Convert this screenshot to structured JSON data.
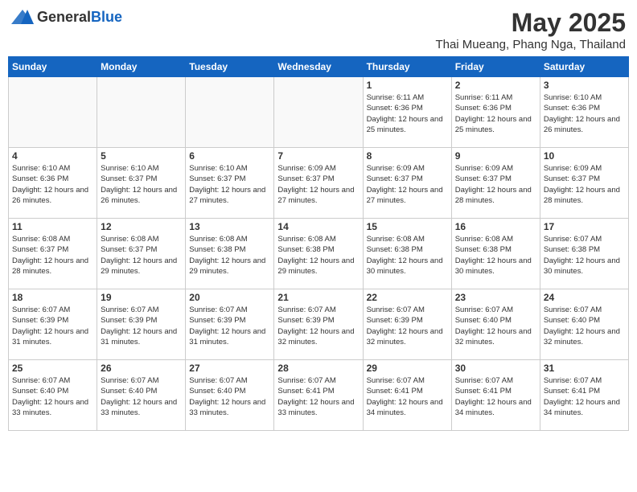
{
  "header": {
    "logo_general": "General",
    "logo_blue": "Blue",
    "title": "May 2025",
    "subtitle": "Thai Mueang, Phang Nga, Thailand"
  },
  "calendar": {
    "days_of_week": [
      "Sunday",
      "Monday",
      "Tuesday",
      "Wednesday",
      "Thursday",
      "Friday",
      "Saturday"
    ],
    "weeks": [
      [
        {
          "day": "",
          "info": ""
        },
        {
          "day": "",
          "info": ""
        },
        {
          "day": "",
          "info": ""
        },
        {
          "day": "",
          "info": ""
        },
        {
          "day": "1",
          "info": "Sunrise: 6:11 AM\nSunset: 6:36 PM\nDaylight: 12 hours\nand 25 minutes."
        },
        {
          "day": "2",
          "info": "Sunrise: 6:11 AM\nSunset: 6:36 PM\nDaylight: 12 hours\nand 25 minutes."
        },
        {
          "day": "3",
          "info": "Sunrise: 6:10 AM\nSunset: 6:36 PM\nDaylight: 12 hours\nand 26 minutes."
        }
      ],
      [
        {
          "day": "4",
          "info": "Sunrise: 6:10 AM\nSunset: 6:36 PM\nDaylight: 12 hours\nand 26 minutes."
        },
        {
          "day": "5",
          "info": "Sunrise: 6:10 AM\nSunset: 6:37 PM\nDaylight: 12 hours\nand 26 minutes."
        },
        {
          "day": "6",
          "info": "Sunrise: 6:10 AM\nSunset: 6:37 PM\nDaylight: 12 hours\nand 27 minutes."
        },
        {
          "day": "7",
          "info": "Sunrise: 6:09 AM\nSunset: 6:37 PM\nDaylight: 12 hours\nand 27 minutes."
        },
        {
          "day": "8",
          "info": "Sunrise: 6:09 AM\nSunset: 6:37 PM\nDaylight: 12 hours\nand 27 minutes."
        },
        {
          "day": "9",
          "info": "Sunrise: 6:09 AM\nSunset: 6:37 PM\nDaylight: 12 hours\nand 28 minutes."
        },
        {
          "day": "10",
          "info": "Sunrise: 6:09 AM\nSunset: 6:37 PM\nDaylight: 12 hours\nand 28 minutes."
        }
      ],
      [
        {
          "day": "11",
          "info": "Sunrise: 6:08 AM\nSunset: 6:37 PM\nDaylight: 12 hours\nand 28 minutes."
        },
        {
          "day": "12",
          "info": "Sunrise: 6:08 AM\nSunset: 6:37 PM\nDaylight: 12 hours\nand 29 minutes."
        },
        {
          "day": "13",
          "info": "Sunrise: 6:08 AM\nSunset: 6:38 PM\nDaylight: 12 hours\nand 29 minutes."
        },
        {
          "day": "14",
          "info": "Sunrise: 6:08 AM\nSunset: 6:38 PM\nDaylight: 12 hours\nand 29 minutes."
        },
        {
          "day": "15",
          "info": "Sunrise: 6:08 AM\nSunset: 6:38 PM\nDaylight: 12 hours\nand 30 minutes."
        },
        {
          "day": "16",
          "info": "Sunrise: 6:08 AM\nSunset: 6:38 PM\nDaylight: 12 hours\nand 30 minutes."
        },
        {
          "day": "17",
          "info": "Sunrise: 6:07 AM\nSunset: 6:38 PM\nDaylight: 12 hours\nand 30 minutes."
        }
      ],
      [
        {
          "day": "18",
          "info": "Sunrise: 6:07 AM\nSunset: 6:39 PM\nDaylight: 12 hours\nand 31 minutes."
        },
        {
          "day": "19",
          "info": "Sunrise: 6:07 AM\nSunset: 6:39 PM\nDaylight: 12 hours\nand 31 minutes."
        },
        {
          "day": "20",
          "info": "Sunrise: 6:07 AM\nSunset: 6:39 PM\nDaylight: 12 hours\nand 31 minutes."
        },
        {
          "day": "21",
          "info": "Sunrise: 6:07 AM\nSunset: 6:39 PM\nDaylight: 12 hours\nand 32 minutes."
        },
        {
          "day": "22",
          "info": "Sunrise: 6:07 AM\nSunset: 6:39 PM\nDaylight: 12 hours\nand 32 minutes."
        },
        {
          "day": "23",
          "info": "Sunrise: 6:07 AM\nSunset: 6:40 PM\nDaylight: 12 hours\nand 32 minutes."
        },
        {
          "day": "24",
          "info": "Sunrise: 6:07 AM\nSunset: 6:40 PM\nDaylight: 12 hours\nand 32 minutes."
        }
      ],
      [
        {
          "day": "25",
          "info": "Sunrise: 6:07 AM\nSunset: 6:40 PM\nDaylight: 12 hours\nand 33 minutes."
        },
        {
          "day": "26",
          "info": "Sunrise: 6:07 AM\nSunset: 6:40 PM\nDaylight: 12 hours\nand 33 minutes."
        },
        {
          "day": "27",
          "info": "Sunrise: 6:07 AM\nSunset: 6:40 PM\nDaylight: 12 hours\nand 33 minutes."
        },
        {
          "day": "28",
          "info": "Sunrise: 6:07 AM\nSunset: 6:41 PM\nDaylight: 12 hours\nand 33 minutes."
        },
        {
          "day": "29",
          "info": "Sunrise: 6:07 AM\nSunset: 6:41 PM\nDaylight: 12 hours\nand 34 minutes."
        },
        {
          "day": "30",
          "info": "Sunrise: 6:07 AM\nSunset: 6:41 PM\nDaylight: 12 hours\nand 34 minutes."
        },
        {
          "day": "31",
          "info": "Sunrise: 6:07 AM\nSunset: 6:41 PM\nDaylight: 12 hours\nand 34 minutes."
        }
      ]
    ]
  }
}
